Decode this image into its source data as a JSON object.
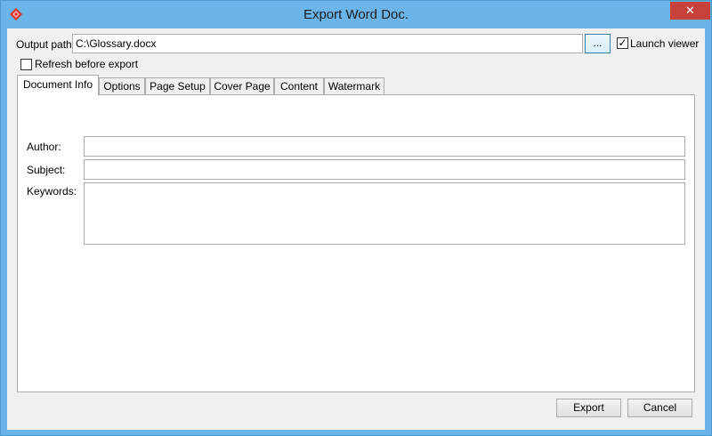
{
  "window": {
    "title": "Export Word Doc.",
    "close_glyph": "✕",
    "icon": "visual-paradigm-app-icon"
  },
  "output": {
    "label": "Output path:",
    "value": "C:\\Glossary.docx",
    "browse_label": "...",
    "launch_viewer_label": "Launch viewer",
    "launch_viewer_checked": true,
    "refresh_label": "Refresh before export",
    "refresh_checked": false
  },
  "tabs": [
    {
      "label": "Document Info",
      "active": true
    },
    {
      "label": "Options",
      "active": false
    },
    {
      "label": "Page Setup",
      "active": false
    },
    {
      "label": "Cover Page",
      "active": false
    },
    {
      "label": "Content",
      "active": false
    },
    {
      "label": "Watermark",
      "active": false
    }
  ],
  "document_info": {
    "author_label": "Author:",
    "author_value": "",
    "subject_label": "Subject:",
    "subject_value": "",
    "keywords_label": "Keywords:",
    "keywords_value": ""
  },
  "footer": {
    "export_label": "Export",
    "cancel_label": "Cancel"
  },
  "colors": {
    "titlebar": "#6ab4ea",
    "close_button": "#c7423a",
    "dialog_bg": "#f0f0f0"
  }
}
